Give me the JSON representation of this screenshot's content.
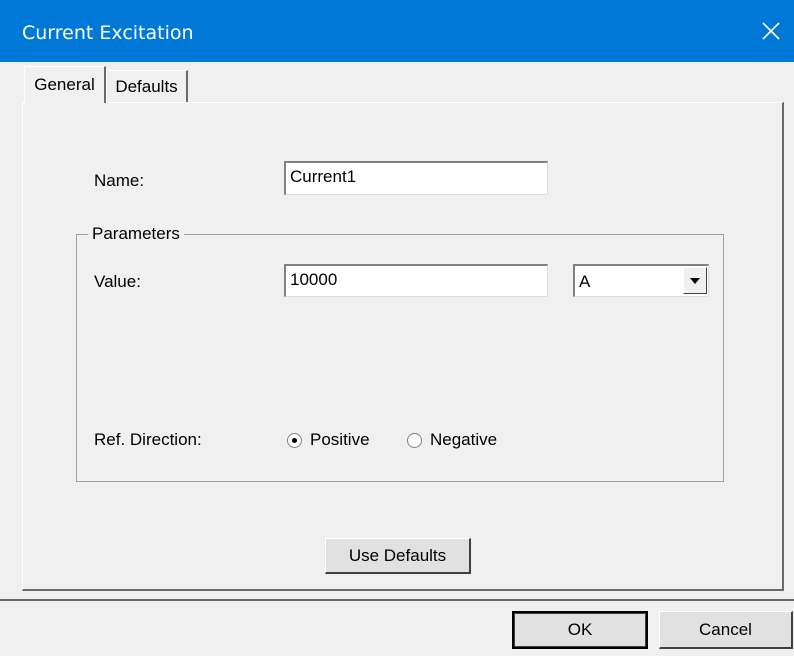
{
  "window": {
    "title": "Current Excitation",
    "close_icon": "close-icon"
  },
  "tabs": [
    {
      "label": "General",
      "active": true
    },
    {
      "label": "Defaults",
      "active": false
    }
  ],
  "general": {
    "name_label": "Name:",
    "name_value": "Current1",
    "parameters_group": "Parameters",
    "value_label": "Value:",
    "value_value": "10000",
    "unit_selected": "A",
    "ref_direction_label": "Ref. Direction:",
    "radio_positive": "Positive",
    "radio_negative": "Negative",
    "ref_direction_selected": "Positive",
    "use_defaults_label": "Use Defaults"
  },
  "footer": {
    "ok_label": "OK",
    "cancel_label": "Cancel"
  }
}
